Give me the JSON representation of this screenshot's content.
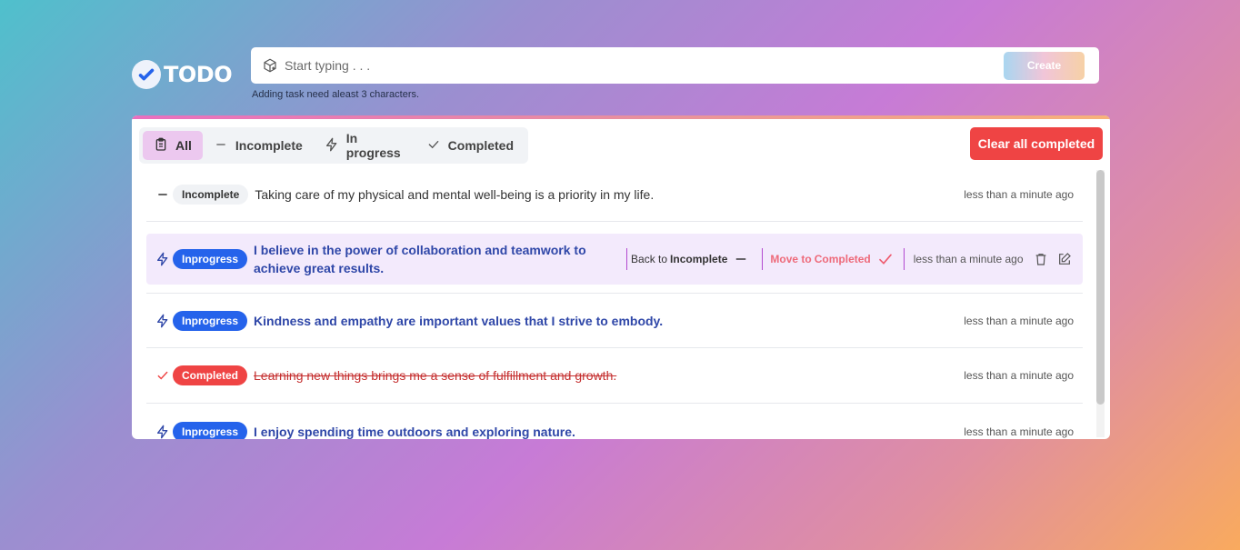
{
  "app": {
    "title": "TODO"
  },
  "create": {
    "placeholder": "Start typing . . .",
    "value": "",
    "button_label": "Create",
    "hint": "Adding task need aleast 3 characters."
  },
  "filters": {
    "tabs": [
      {
        "label": "All",
        "icon": "clipboard-icon",
        "active": true
      },
      {
        "label": "Incomplete",
        "icon": "minus-icon",
        "active": false
      },
      {
        "label": "In progress",
        "icon": "lightning-icon",
        "active": false
      },
      {
        "label": "Completed",
        "icon": "check-icon",
        "active": false
      }
    ],
    "clear_label": "Clear all completed"
  },
  "tasks": [
    {
      "status": "incomplete",
      "badge": "Incomplete",
      "text": "Taking care of my physical and mental well-being is a priority in my life.",
      "time": "less than a minute ago"
    },
    {
      "status": "progress",
      "badge": "Inprogress",
      "text": "I believe in the power of collaboration and teamwork to achieve great results.",
      "time": "less than a minute ago",
      "hovered": true
    },
    {
      "status": "progress",
      "badge": "Inprogress",
      "text": "Kindness and empathy are important values that I strive to embody.",
      "time": "less than a minute ago"
    },
    {
      "status": "completed",
      "badge": "Completed",
      "text": "Learning new things brings me a sense of fulfillment and growth.",
      "time": "less than a minute ago"
    },
    {
      "status": "progress",
      "badge": "Inprogress",
      "text": "I enjoy spending time outdoors and exploring nature.",
      "time": "less than a minute ago"
    }
  ],
  "row_actions": {
    "back_prefix": "Back to",
    "back_target": "Incomplete",
    "move_prefix": "Move to",
    "move_target": "Completed"
  },
  "colors": {
    "progress": "#2563eb",
    "completed": "#ef4444",
    "incomplete": "#f0f2f5"
  }
}
